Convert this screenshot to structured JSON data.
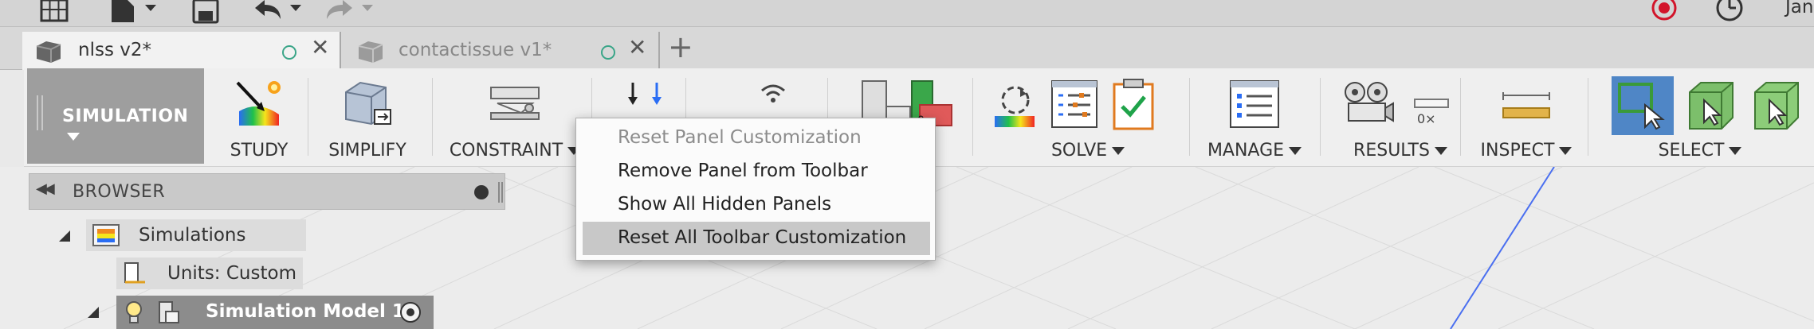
{
  "user_initial": "Jan",
  "tabs": [
    {
      "label": "nlss v2*"
    },
    {
      "label": "contactissue v1*"
    }
  ],
  "workspace": {
    "label": "SIMULATION"
  },
  "toolbar": {
    "study": "STUDY",
    "simplify": "SIMPLIFY",
    "constraint": "CONSTRAINT",
    "solve": "SOLVE",
    "manage": "MANAGE",
    "results": "RESULTS",
    "inspect": "INSPECT",
    "select": "SELECT",
    "results_scale": "0×"
  },
  "browser": {
    "title": "BROWSER",
    "simulations": "Simulations",
    "units": "Units: Custom",
    "model": "Simulation Model 1"
  },
  "context_menu": {
    "items": [
      {
        "label": "Reset Panel Customization",
        "state": "disabled"
      },
      {
        "label": "Remove Panel from Toolbar",
        "state": "normal"
      },
      {
        "label": "Show All Hidden Panels",
        "state": "normal"
      },
      {
        "label": "Reset All Toolbar Customization",
        "state": "highlighted"
      }
    ]
  },
  "colors": {
    "accent_green": "#3aa588",
    "selection_blue": "#4f86c6",
    "workspace_gray": "#9e9e9e",
    "record_red": "#d2142a"
  }
}
